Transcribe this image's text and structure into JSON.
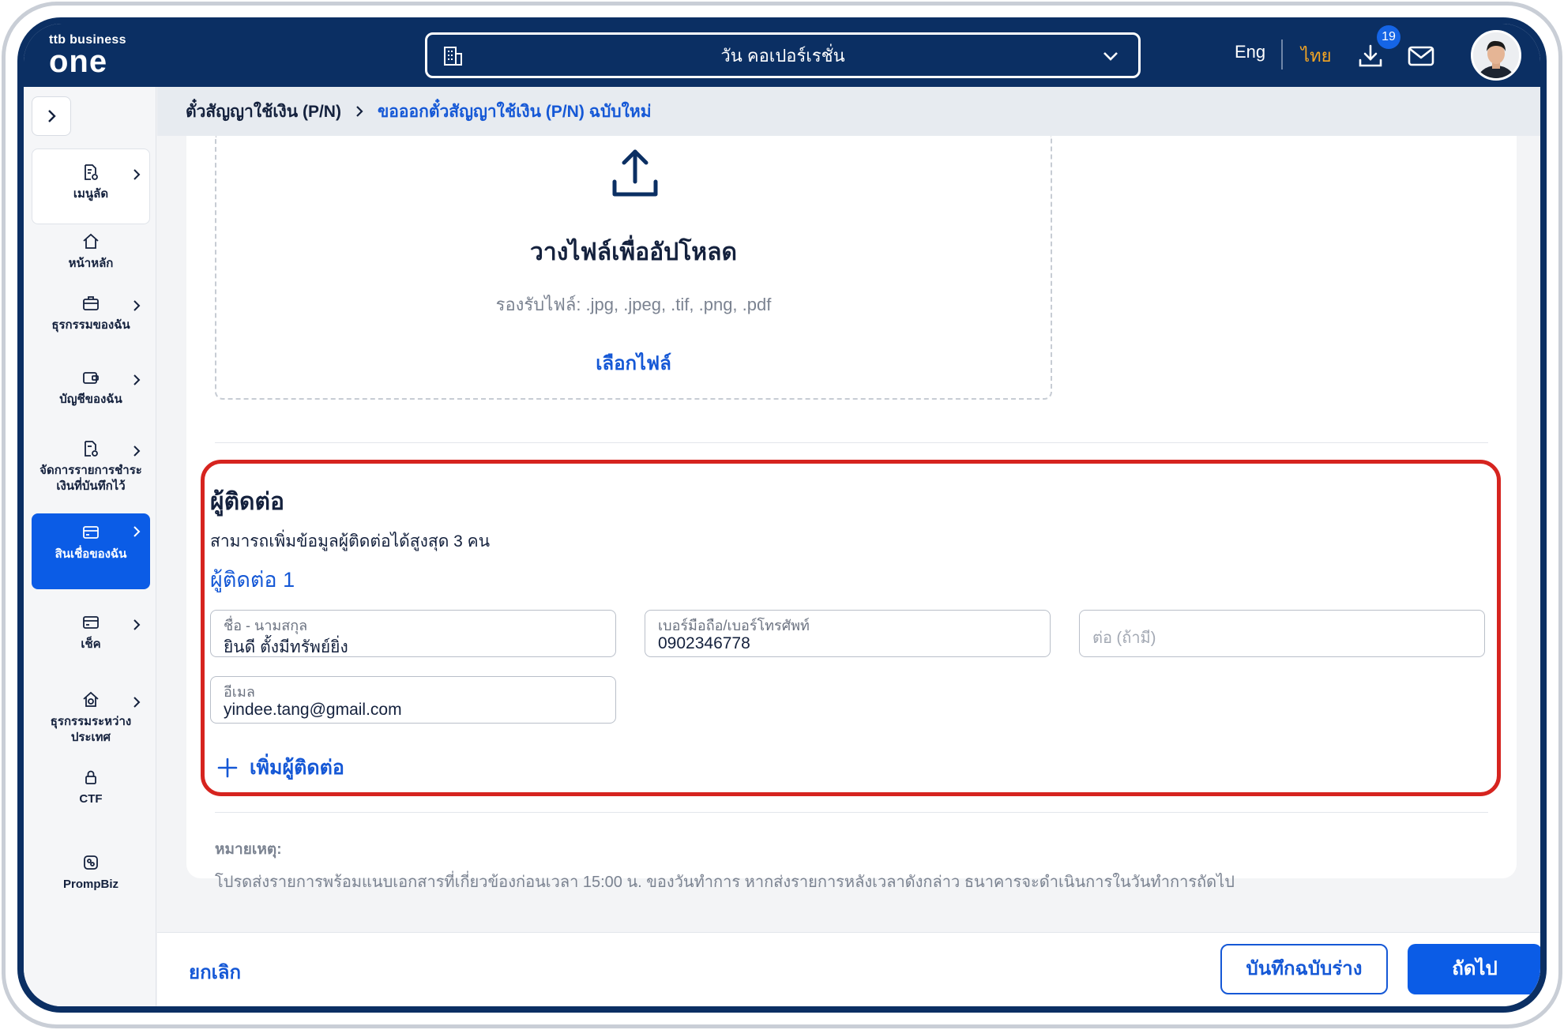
{
  "header": {
    "logo_small": "ttb business",
    "logo_big": "one",
    "company": "วัน คอเปอร์เรชั่น",
    "lang_en": "Eng",
    "lang_th": "ไทย",
    "download_badge": "19"
  },
  "sidebar": {
    "items": [
      {
        "label": "เมนูลัด"
      },
      {
        "label": "หน้าหลัก"
      },
      {
        "label": "ธุรกรรมของฉัน"
      },
      {
        "label": "บัญชีของฉัน"
      },
      {
        "label": "จัดการรายการชำระเงินที่บันทึกไว้"
      },
      {
        "label": "สินเชื่อของฉัน"
      },
      {
        "label": "เช็ค"
      },
      {
        "label": "ธุรกรรมระหว่างประเทศ"
      },
      {
        "label": "CTF"
      },
      {
        "label": "PrompBiz"
      }
    ]
  },
  "breadcrumb": {
    "parent": "ตั๋วสัญญาใช้เงิน (P/N)",
    "current": "ขอออกตั๋วสัญญาใช้เงิน (P/N) ฉบับใหม่"
  },
  "upload": {
    "title": "วางไฟล์เพื่ออัปโหลด",
    "hint": "รองรับไฟล์: .jpg, .jpeg, .tif, .png, .pdf",
    "choose": "เลือกไฟล์"
  },
  "contact": {
    "title": "ผู้ติดต่อ",
    "subtitle": "สามารถเพิ่มข้อมูลผู้ติดต่อได้สูงสุด 3 คน",
    "contact_heading": "ผู้ติดต่อ 1",
    "name_label": "ชื่อ - นามสกุล",
    "name_value": "ยินดี ตั้งมีทรัพย์ยิ่ง",
    "phone_label": "เบอร์มือถือ/เบอร์โทรศัพท์",
    "phone_value": "0902346778",
    "ext_placeholder": "ต่อ (ถ้ามี)",
    "email_label": "อีเมล",
    "email_value": "yindee.tang@gmail.com",
    "add_label": "เพิ่มผู้ติดต่อ"
  },
  "note": {
    "title": "หมายเหตุ:",
    "text": "โปรดส่งรายการพร้อมแนบเอกสารที่เกี่ยวข้องก่อนเวลา 15:00 น. ของวันทำการ หากส่งรายการหลังเวลาดังกล่าว ธนาคารจะดำเนินการในวันทำการถัดไป"
  },
  "footer": {
    "cancel": "ยกเลิก",
    "save_draft": "บันทึกฉบับร่าง",
    "next": "ถัดไป"
  },
  "colors": {
    "navy": "#0b2f63",
    "primary": "#0b5ce6",
    "link": "#1558d6",
    "highlight": "#d6241f",
    "lang_active": "#f5a623"
  }
}
